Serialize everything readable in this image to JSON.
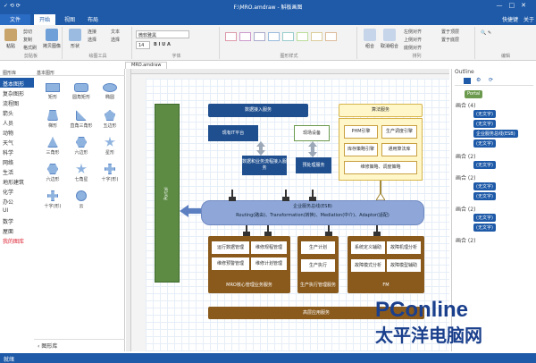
{
  "window": {
    "title": "F:\\MRO.amdraw - 斛板画图",
    "quick_access": "✓ ⟲ ⟳"
  },
  "tabs": {
    "file": "文件",
    "start": "开始",
    "view": "视图",
    "layout": "布局",
    "user": "快捷键",
    "about": "关于"
  },
  "ribbon": {
    "paste": "粘贴",
    "cut": "剪切",
    "copy": "复制",
    "clear": "清除",
    "painter": "格式刷",
    "brush": "拷贝图像",
    "select": "选择",
    "connect": "连接",
    "text": "文本",
    "swap": "选择",
    "shape_label": "形状",
    "font_name": "微软雅黑",
    "font_size": "14",
    "group_clipboard": "剪贴板",
    "group_tools": "绘图工具",
    "group_font": "字体",
    "group_style": "图形样式",
    "group_arrange": "排列",
    "group_edit": "编辑",
    "align_top": "左侧对齐",
    "align_mid": "上侧对齐",
    "align_bot": "底侧对齐",
    "arrange_front": "置于顶层",
    "arrange_back": "置于底层",
    "group_btn": "组合",
    "ungroup_btn": "取消组合"
  },
  "left": {
    "head_a": "图形库",
    "head_b": "基本图形",
    "categories": [
      "基本图形",
      "复杂图形",
      "流程图",
      "箭头",
      "人员",
      "动物",
      "天气",
      "科学",
      "网络",
      "生活",
      "地形建筑",
      "化学",
      "办公",
      "UI",
      "数学",
      "屋面",
      "我的图库"
    ],
    "shapes": [
      "矩形",
      "圆角矩形",
      "椭圆",
      "梯形",
      "直角三角形",
      "五边形",
      "三角形",
      "六边形",
      "星形",
      "六边形",
      "七角星",
      "十字(形)",
      "十字(形)",
      "云"
    ],
    "footer": "图形库"
  },
  "doc_tab": "MRO.amdraw",
  "diagram": {
    "portal": "Portal",
    "data_in": "数据接入服务",
    "algo": "算法服务",
    "src_a": "现有IT平台",
    "src_b": "现场设备",
    "in_a": "数据和业务流程接入服务",
    "in_b": "预处理服务",
    "phm": "PHM引擎",
    "ps": "生产调度引擎",
    "ls": "库存策略引擎",
    "ts": "通用算法库",
    "maint": "维修策略、调度策略",
    "esb_1": "企业服务总线(ESB)",
    "esb_2": "Routing(路由)、Transformation(转换)、Mediation(中介)、Adaptor(适配)",
    "mro_1": "运行数据管理",
    "mro_2": "维修规程管理",
    "mro_3": "维修预警管理",
    "mro_4": "维修计划管理",
    "mro_title": "MRO核心管理业务服务",
    "prod_1": "生产计划",
    "prod_2": "生产执行",
    "prod_title": "生产执行管理服务",
    "fm_1": "系统定义辅助",
    "fm_2": "故障机理分析",
    "fm_3": "故障模式分析",
    "fm_4": "故障模型辅助",
    "fm_title": "FM",
    "bottom": "高层应用服务"
  },
  "right": {
    "title": "Outline",
    "items": [
      {
        "label": "画合 (4)",
        "chips": [
          "(无文字)",
          "(无文字)",
          "企业服务总线(ESB)",
          "(无文字)"
        ]
      },
      {
        "label": "画合 (2)",
        "chips": [
          "(无文字)"
        ]
      },
      {
        "label": "画合 (2)",
        "chips": [
          "(无文字)",
          "(无文字)"
        ]
      },
      {
        "label": "画合 (2)",
        "chips": [
          "(无文字)",
          "(无文字)"
        ]
      },
      {
        "label": "画合 (2)",
        "chips": []
      }
    ],
    "root": "Portal"
  },
  "status": "就绪",
  "watermark": {
    "brand": "PConline",
    "cn": "太平洋电脑网"
  },
  "colors": {
    "accent": "#1e5aa8",
    "box_blue": "#1f4f8f",
    "box_brown": "#8a5a1c",
    "gold": "#fff6c9",
    "esb": "#8fa7d8",
    "portal": "#6b9a4e"
  }
}
